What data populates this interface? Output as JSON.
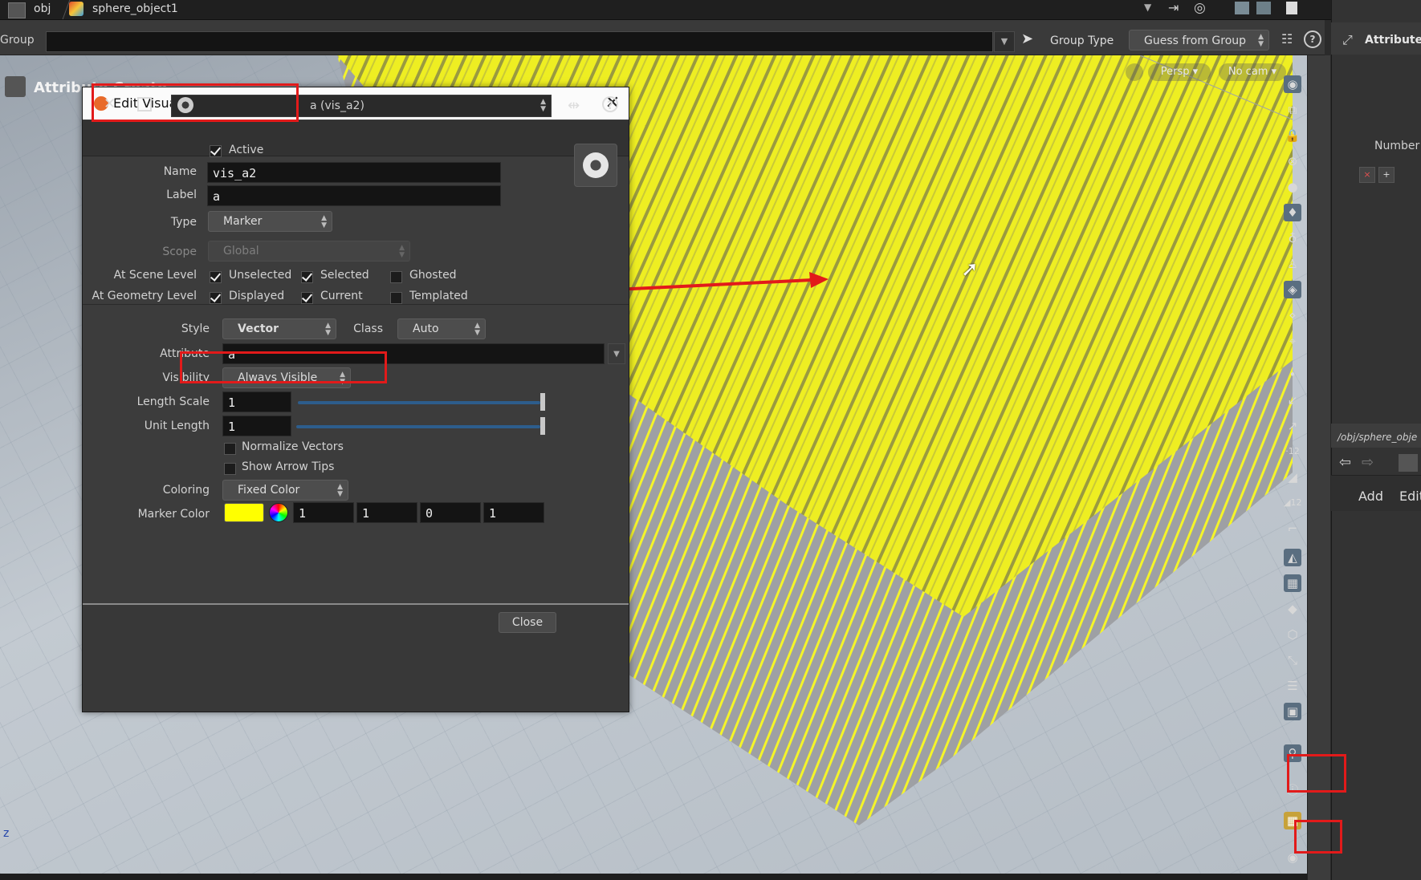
{
  "path_bar": {
    "crumbs": [
      "obj",
      "sphere_object1"
    ]
  },
  "group_bar": {
    "group_label": "Group",
    "group_value": "",
    "group_type_label": "Group Type",
    "group_type_value": "Guess from Group"
  },
  "viewport": {
    "title": "Attribute Create",
    "persp": "Persp ▾",
    "camera": "No cam ▾"
  },
  "right_pane": {
    "title": "Attribute",
    "number_label": "Number",
    "network_path": "/obj/sphere_obje",
    "add": "Add",
    "edit": "Edit"
  },
  "dialog": {
    "title": "Edit Visualizer",
    "selector": "a (vis_a2)",
    "active_label": "Active",
    "active": true,
    "name_label": "Name",
    "name_value": "vis_a2",
    "label_label": "Label",
    "label_value": "a",
    "type_label": "Type",
    "type_value": "Marker",
    "scope_label": "Scope",
    "scope_value": "Global",
    "scene_level_label": "At Scene Level",
    "geometry_level_label": "At Geometry Level",
    "unselected": "Unselected",
    "selected": "Selected",
    "ghosted": "Ghosted",
    "displayed": "Displayed",
    "current": "Current",
    "templated": "Templated",
    "style_label": "Style",
    "style_value": "Vector",
    "class_label": "Class",
    "class_value": "Auto",
    "attribute_label": "Attribute",
    "attribute_value": "a",
    "visibility_label": "Visibility",
    "visibility_value": "Always Visible",
    "length_scale_label": "Length Scale",
    "length_scale_value": "1",
    "unit_length_label": "Unit Length",
    "unit_length_value": "1",
    "normalize_label": "Normalize Vectors",
    "arrow_tips_label": "Show Arrow Tips",
    "coloring_label": "Coloring",
    "coloring_value": "Fixed Color",
    "marker_color_label": "Marker Color",
    "marker_color_hex": "#ffff00",
    "marker_rgba": [
      "1",
      "1",
      "0",
      "1"
    ],
    "close_button": "Close"
  },
  "colors": {
    "annotation_red": "#e21a1a",
    "vector_yellow": "#ffff00",
    "slider_blue": "#2d5d8c"
  }
}
